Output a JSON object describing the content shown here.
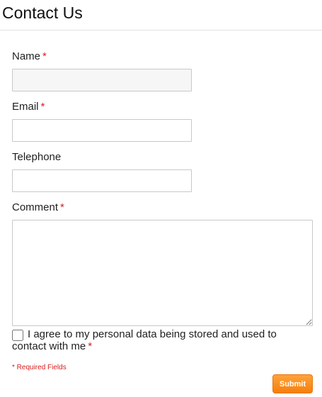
{
  "page": {
    "title": "Contact Us"
  },
  "form": {
    "required_marker": "*",
    "name": {
      "label": "Name",
      "value": "",
      "required": true
    },
    "email": {
      "label": "Email",
      "value": "",
      "required": true
    },
    "telephone": {
      "label": "Telephone",
      "value": "",
      "required": false
    },
    "comment": {
      "label": "Comment",
      "value": "",
      "required": true
    },
    "consent": {
      "label": "I agree to my personal data being stored and used to contact with me",
      "checked": false,
      "required": true
    },
    "required_note": "* Required Fields",
    "submit_label": "Submit"
  },
  "colors": {
    "required": "#d42020",
    "submit_button": "#f68a1e",
    "divider": "#e3e3e3"
  }
}
